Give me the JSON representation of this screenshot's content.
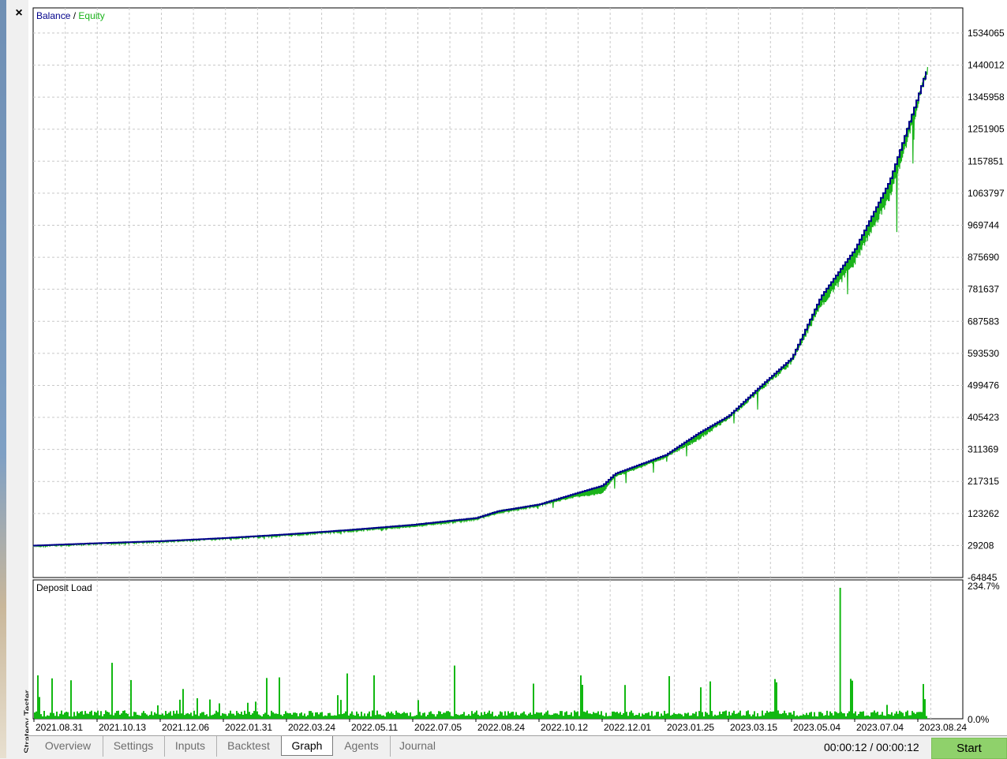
{
  "panel": {
    "title": "Strategy Tester",
    "close_symbol": "×"
  },
  "tabs": [
    {
      "label": "Overview",
      "active": false
    },
    {
      "label": "Settings",
      "active": false
    },
    {
      "label": "Inputs",
      "active": false
    },
    {
      "label": "Backtest",
      "active": false
    },
    {
      "label": "Graph",
      "active": true
    },
    {
      "label": "Agents",
      "active": false
    },
    {
      "label": "Journal",
      "active": false
    }
  ],
  "status": {
    "timer": "00:00:12 / 00:00:12",
    "start_label": "Start"
  },
  "colors": {
    "balance": "#00008b",
    "equity": "#1ab31a",
    "deposit_load": "#12b812",
    "grid": "#c8c8c8",
    "start_button": "#8fd16b"
  },
  "chart_data": [
    {
      "type": "line",
      "legend": {
        "placement": "top-left",
        "entries": [
          "Balance",
          "Equity"
        ],
        "separator": " / "
      },
      "y_ticks": [
        "1534065",
        "1440012",
        "1345958",
        "1251905",
        "1157851",
        "1063797",
        "969744",
        "875690",
        "781637",
        "687583",
        "593530",
        "499476",
        "405423",
        "311369",
        "217315",
        "123262",
        "29208",
        "-64845"
      ],
      "ylim": [
        -64845,
        1608000
      ],
      "x_ticks": [
        "2021.08.31",
        "2021.10.13",
        "2021.12.06",
        "2022.01.31",
        "2022.03.24",
        "2022.05.11",
        "2022.07.05",
        "2022.08.24",
        "2022.10.12",
        "2022.12.01",
        "2023.01.25",
        "2023.03.15",
        "2023.05.04",
        "2023.07.04",
        "2023.08.24"
      ],
      "x": [
        "2021.08.31",
        "2021.10.13",
        "2021.12.06",
        "2022.01.31",
        "2022.03.24",
        "2022.05.11",
        "2022.07.05",
        "2022.08.24",
        "2022.09.10",
        "2022.10.12",
        "2022.11.08",
        "2022.12.01",
        "2022.12.12",
        "2023.01.25",
        "2023.02.20",
        "2023.03.15",
        "2023.04.10",
        "2023.05.04",
        "2023.06.01",
        "2023.07.04",
        "2023.08.01",
        "2023.08.24",
        "2023.09.01"
      ],
      "series": [
        {
          "name": "Balance",
          "values": [
            29000,
            36000,
            42000,
            51000,
            62000,
            75000,
            90000,
            110000,
            130000,
            150000,
            180000,
            205000,
            240000,
            295000,
            360000,
            410000,
            500000,
            580000,
            760000,
            900000,
            1100000,
            1350000,
            1440000
          ]
        },
        {
          "name": "Equity",
          "values": [
            27000,
            34000,
            40000,
            49000,
            58000,
            71000,
            82000,
            103000,
            120000,
            145000,
            160000,
            150000,
            220000,
            280000,
            320000,
            400000,
            480000,
            560000,
            700000,
            820000,
            1000000,
            1300000,
            1480000
          ]
        }
      ],
      "grid": true
    },
    {
      "type": "bar",
      "title": "Deposit Load",
      "y_ticks": [
        "234.7%",
        "0.0%"
      ],
      "ylim": [
        0,
        234.7
      ],
      "baseline_percent": 10,
      "peak_percent": 234.7
    }
  ]
}
